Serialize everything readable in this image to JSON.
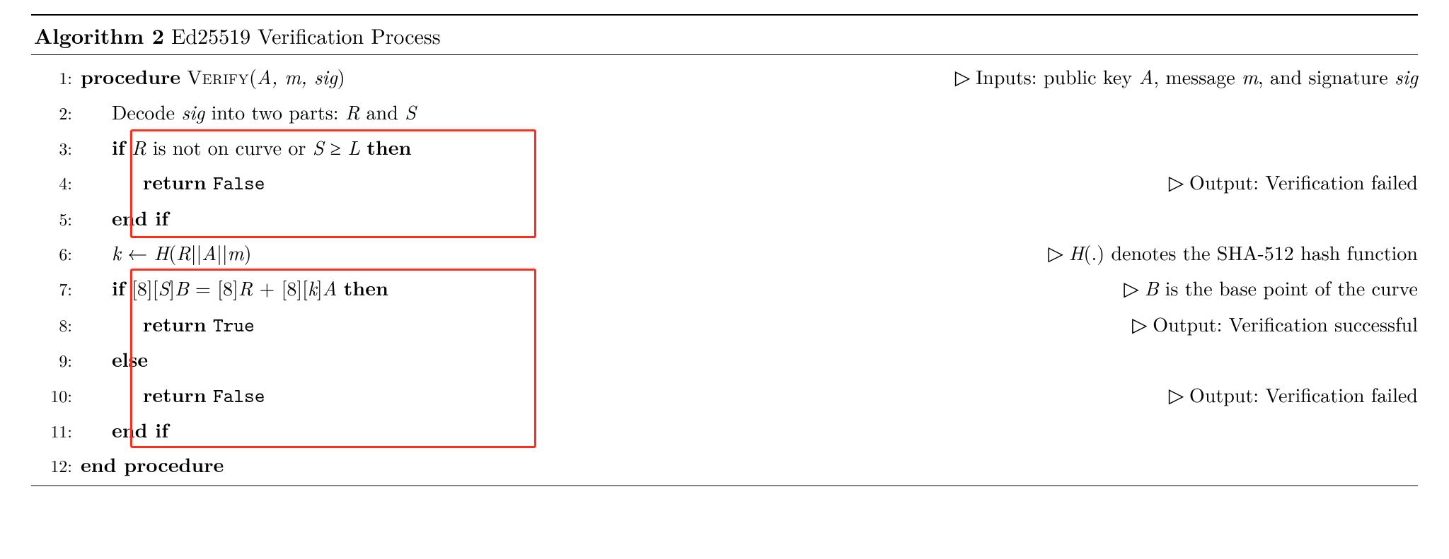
{
  "title": {
    "label": "Algorithm 2",
    "caption": "Ed25519 Verification Process"
  },
  "lines": {
    "l1": {
      "no": "1:",
      "kw1": "procedure",
      "name": "Verify",
      "args_a": "A, m, sig",
      "comment": "Inputs: public key",
      "ca": "A",
      "cm1": ", message",
      "cm": "m",
      "cm2": ", and signature",
      "csig": "sig"
    },
    "l2": {
      "no": "2:",
      "t1": "Decode",
      "sig": "sig",
      "t2": "into two parts:",
      "r": "R",
      "and": "and",
      "s": "S"
    },
    "l3": {
      "no": "3:",
      "kw": "if",
      "r": "R",
      "t1": "is not on curve or",
      "s": "S",
      "ge": "≥",
      "L": "L",
      "then": "then"
    },
    "l4": {
      "no": "4:",
      "kw": "return",
      "val": "False",
      "comment": "Output: Verification failed"
    },
    "l5": {
      "no": "5:",
      "kw": "end if"
    },
    "l6": {
      "no": "6:",
      "k": "k",
      "arrow": "←",
      "h": "H",
      "r": "R",
      "a": "A",
      "m": "m",
      "comment_h": "H",
      "comment": "(.) denotes the SHA-512 hash function"
    },
    "l7": {
      "no": "7:",
      "kw": "if",
      "eq": "[8][S]B = [8]R + [8][k]A",
      "s": "S",
      "b": "B",
      "r": "R",
      "k": "k",
      "a": "A",
      "then": "then",
      "cb": "B",
      "comment": "is the base point of the curve"
    },
    "l8": {
      "no": "8:",
      "kw": "return",
      "val": "True",
      "comment": "Output: Verification successful"
    },
    "l9": {
      "no": "9:",
      "kw": "else"
    },
    "l10": {
      "no": "10:",
      "kw": "return",
      "val": "False",
      "comment": "Output: Verification failed"
    },
    "l11": {
      "no": "11:",
      "kw": "end if"
    },
    "l12": {
      "no": "12:",
      "kw": "end procedure"
    }
  }
}
